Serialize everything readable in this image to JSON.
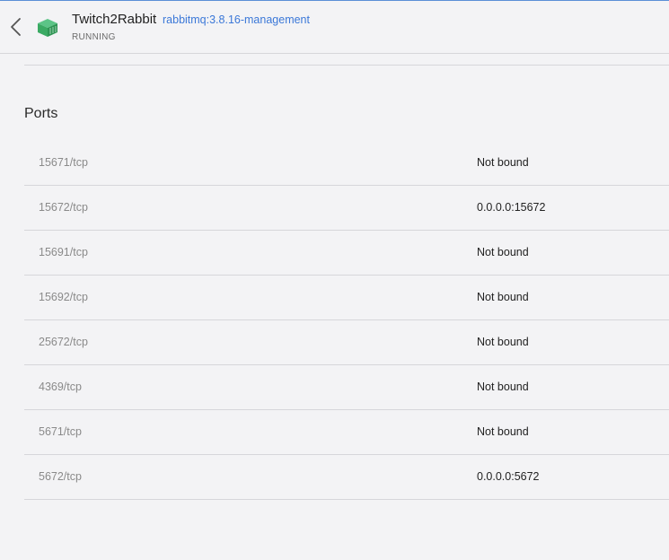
{
  "header": {
    "back_icon": "chevron-left-icon",
    "container_icon": "container-icon",
    "container_icon_color": "#3aaa63",
    "title": "Twitch2Rabbit",
    "image": "rabbitmq:3.8.16-management",
    "status": "RUNNING"
  },
  "ports": {
    "section_title": "Ports",
    "rows": [
      {
        "port": "15671/tcp",
        "binding": "Not bound"
      },
      {
        "port": "15672/tcp",
        "binding": "0.0.0.0:15672"
      },
      {
        "port": "15691/tcp",
        "binding": "Not bound"
      },
      {
        "port": "15692/tcp",
        "binding": "Not bound"
      },
      {
        "port": "25672/tcp",
        "binding": "Not bound"
      },
      {
        "port": "4369/tcp",
        "binding": "Not bound"
      },
      {
        "port": "5671/tcp",
        "binding": "Not bound"
      },
      {
        "port": "5672/tcp",
        "binding": "0.0.0.0:5672"
      }
    ]
  }
}
